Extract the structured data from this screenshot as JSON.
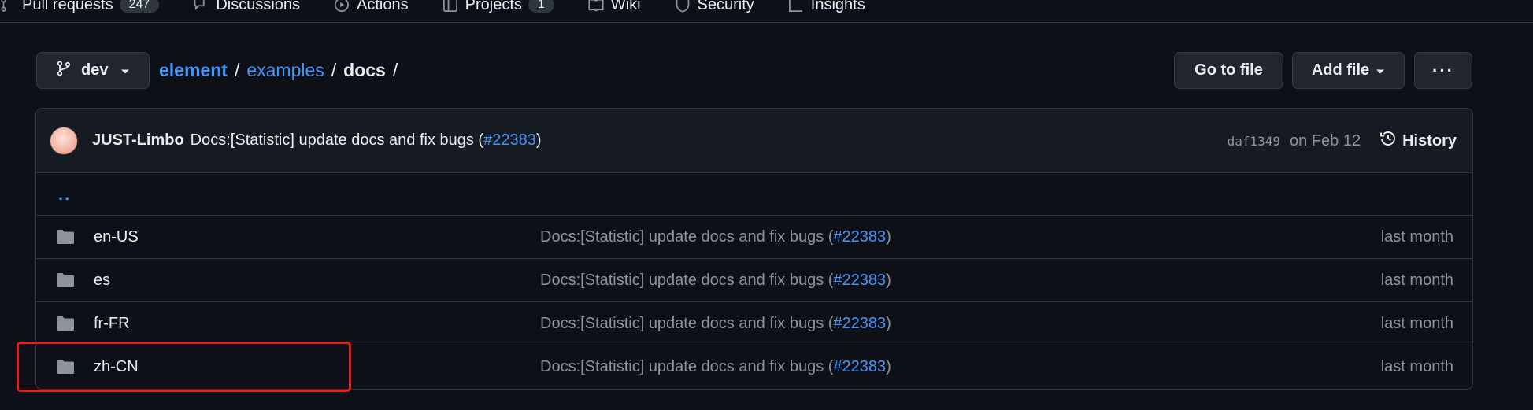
{
  "top_tabs": [
    {
      "label": "Pull requests",
      "counter": "247",
      "icon": "pull-request-icon"
    },
    {
      "label": "Discussions",
      "icon": "discussions-icon"
    },
    {
      "label": "Actions",
      "icon": "actions-icon"
    },
    {
      "label": "Projects",
      "counter": "1",
      "icon": "projects-icon"
    },
    {
      "label": "Wiki",
      "icon": "wiki-icon"
    },
    {
      "label": "Security",
      "icon": "shield-icon"
    },
    {
      "label": "Insights",
      "icon": "insights-icon"
    }
  ],
  "branch": {
    "name": "dev"
  },
  "breadcrumb": {
    "repo": "element",
    "dir1": "examples",
    "current": "docs",
    "sep": "/"
  },
  "actions": {
    "goto": "Go to file",
    "add": "Add file",
    "more": "···"
  },
  "latest_commit": {
    "author": "JUST-Limbo",
    "message_prefix": "Docs:[Statistic] update docs and fix bugs (",
    "pr": "#22383",
    "message_suffix": ")",
    "sha": "daf1349",
    "date": "on Feb 12",
    "history_label": "History"
  },
  "parent_dir": "..",
  "files": [
    {
      "name": "en-US",
      "msg_prefix": "Docs:[Statistic] update docs and fix bugs (",
      "pr": "#22383",
      "msg_suffix": ")",
      "age": "last month"
    },
    {
      "name": "es",
      "msg_prefix": "Docs:[Statistic] update docs and fix bugs (",
      "pr": "#22383",
      "msg_suffix": ")",
      "age": "last month"
    },
    {
      "name": "fr-FR",
      "msg_prefix": "Docs:[Statistic] update docs and fix bugs (",
      "pr": "#22383",
      "msg_suffix": ")",
      "age": "last month"
    },
    {
      "name": "zh-CN",
      "msg_prefix": "Docs:[Statistic] update docs and fix bugs (",
      "pr": "#22383",
      "msg_suffix": ")",
      "age": "last month"
    }
  ],
  "colors": {
    "background": "#0d1117",
    "link": "#4493f8",
    "muted": "#8b949e",
    "highlight": "#e3211c"
  }
}
